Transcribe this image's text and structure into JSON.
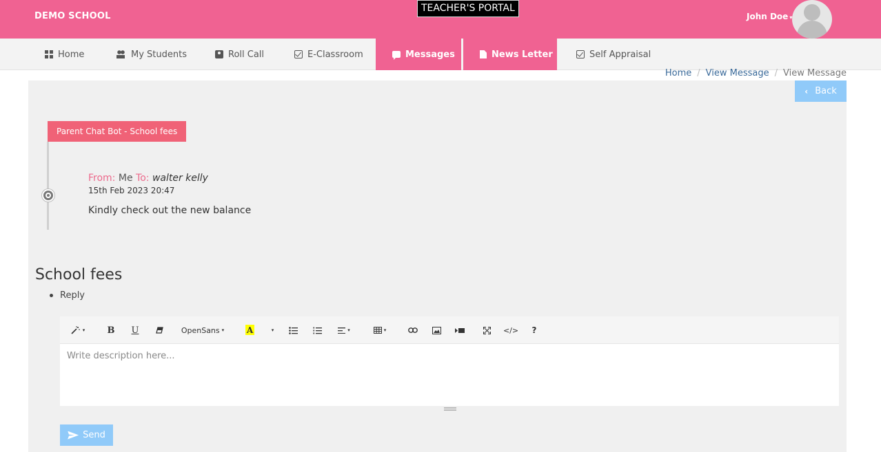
{
  "header": {
    "brand": "DEMO SCHOOL",
    "portal_title": "TEACHER'S PORTAL",
    "user_name": "John Doe",
    "bg_color": "#f06292"
  },
  "nav": {
    "items": [
      {
        "label": "Home",
        "icon": "grid-icon"
      },
      {
        "label": "My Students",
        "icon": "people-icon"
      },
      {
        "label": "Roll Call",
        "icon": "badge-icon"
      },
      {
        "label": "E-Classroom",
        "icon": "checkbox-icon"
      },
      {
        "label": "Messages",
        "icon": "chat-icon",
        "active": true
      },
      {
        "label": "News Letter",
        "icon": "document-icon",
        "active": true
      },
      {
        "label": "Self Appraisal",
        "icon": "checkbox-icon"
      }
    ]
  },
  "breadcrumb": {
    "home": "Home",
    "view_message": "View Message",
    "current": "View Message"
  },
  "back_label": "Back",
  "thread": {
    "label": "Parent Chat Bot - School fees",
    "from_label": "From:",
    "from": "Me",
    "to_label": "To:",
    "to": "walter kelly",
    "date": "15th Feb 2023 20:47",
    "body": "Kindly check out the new balance"
  },
  "subject": "School fees",
  "reply_label": "Reply",
  "editor": {
    "font_name": "OpenSans",
    "placeholder": "Write description here...",
    "bold": "B",
    "underline": "U",
    "color_letter": "A",
    "help": "?",
    "code": "</>"
  },
  "send_label": "Send",
  "colors": {
    "accent": "#f06292",
    "button": "#90caf9",
    "thread_label": "#f06277",
    "panel": "#f0f0f0"
  }
}
